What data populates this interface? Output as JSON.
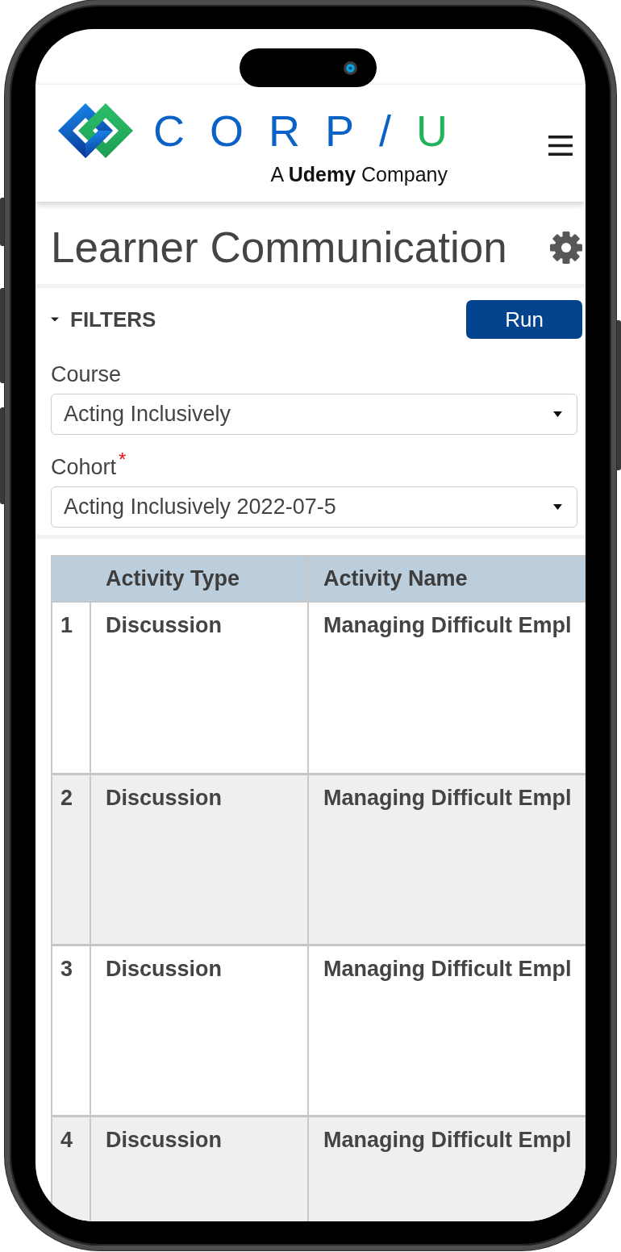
{
  "header": {
    "logo": {
      "wordmark": [
        {
          "text": "CORP/",
          "color": "#0b62c6"
        },
        {
          "text": "U",
          "color": "#22b35d"
        }
      ],
      "tagline": "A **Udemy** Company"
    }
  },
  "page": {
    "title": "Learner Communication"
  },
  "filters": {
    "title": "FILTERS",
    "expanded": true,
    "run_button": "Run",
    "fields": [
      {
        "label": "Course",
        "value": "Acting Inclusively"
      },
      {
        "label": "Cohort",
        "required_mark": "*",
        "value": "Acting Inclusively 2022-07-5"
      }
    ]
  },
  "table": {
    "columns": [
      "Activity Type",
      "Activity Name"
    ],
    "rows": [
      {
        "number": "1",
        "activity_type": "Discussion",
        "activity_name": "Managing Difficult Empl"
      },
      {
        "number": "2",
        "activity_type": "Discussion",
        "activity_name": "Managing Difficult Empl"
      },
      {
        "number": "3",
        "activity_type": "Discussion",
        "activity_name": "Managing Difficult Empl"
      },
      {
        "number": "4",
        "activity_type": "Discussion",
        "activity_name": "Managing Difficult Empl"
      }
    ]
  }
}
